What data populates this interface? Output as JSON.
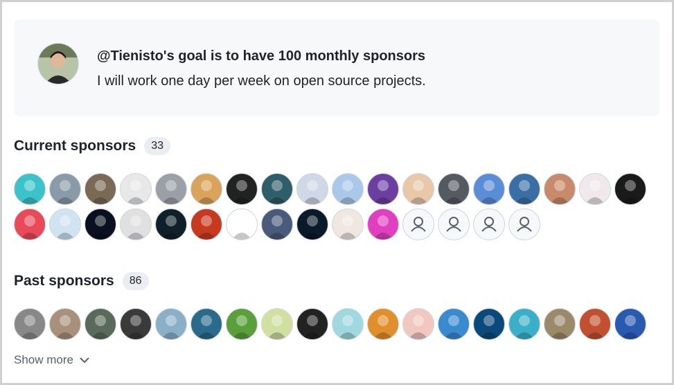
{
  "goal": {
    "title": "@Tienisto's goal is to have 100 monthly sponsors",
    "description": "I will work one day per week on open source projects."
  },
  "current_sponsors": {
    "label": "Current sponsors",
    "count": "33",
    "avatars": [
      "#3cc3c9",
      "#8a9aa8",
      "#7a6a55",
      "#e8e8e8",
      "#9aa0a6",
      "#d9a35a",
      "#222222",
      "#2f5d6a",
      "#d0d8e8",
      "#a9c8ea",
      "#6b3fa0",
      "#e8c8a8",
      "#555a60",
      "#5b8dd6",
      "#3a6fa5",
      "#c88a6a",
      "#f0e8ea",
      "#1a1a1a",
      "#e84a5a",
      "#cfe3f3",
      "#0a1020",
      "#e0e0e0",
      "#10202a",
      "#c83a20",
      "#ffffff",
      "#4a5a7a",
      "#0a1a2a",
      "#f0e8e0",
      "#e040c0",
      "default",
      "default",
      "default",
      "default"
    ]
  },
  "past_sponsors": {
    "label": "Past sponsors",
    "count": "86",
    "avatars": [
      "#888888",
      "#a8907a",
      "#5a6a5a",
      "#3a3a3a",
      "#8ab0c8",
      "#2a6a8a",
      "#5aa03a",
      "#d0e0a0",
      "#222222",
      "#a0d8e0",
      "#e0902a",
      "#f0c8c0",
      "#3a8ad0",
      "#0a4a7a",
      "#3ab0c8",
      "#9a8a6a",
      "#c05030",
      "#2a5ab0"
    ]
  },
  "show_more": "Show more"
}
